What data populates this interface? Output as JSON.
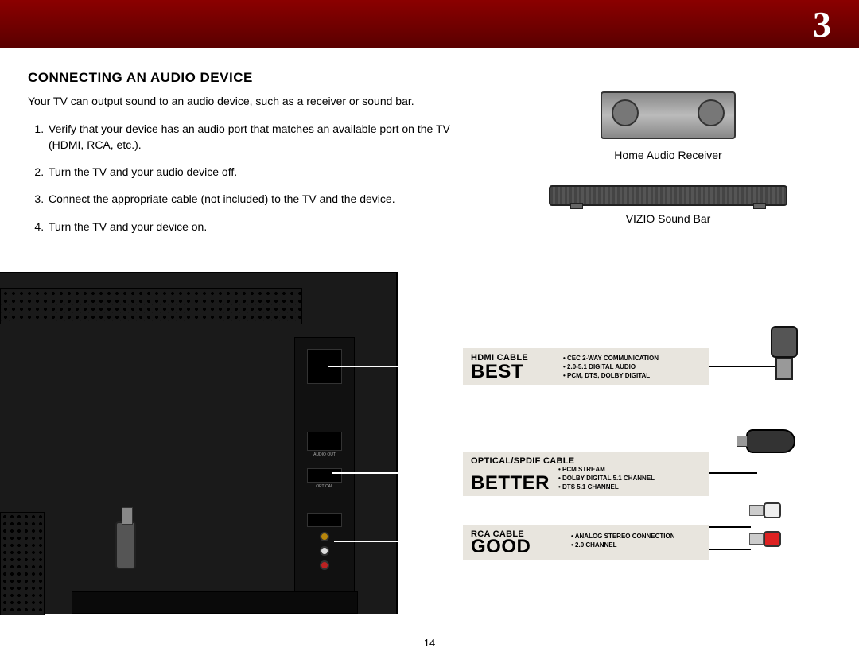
{
  "chapter_number": "3",
  "section_title": "CONNECTING AN AUDIO DEVICE",
  "intro": "Your TV can output sound to an audio device, such as a receiver or sound bar.",
  "steps": [
    "Verify that your device has an audio port that matches an available port on the TV (HDMI, RCA, etc.).",
    "Turn the TV and your audio device off.",
    "Connect the appropriate cable (not included) to the TV and the device.",
    "Turn the TV and your device on."
  ],
  "devices": {
    "receiver_label": "Home Audio Receiver",
    "soundbar_label": "VIZIO Sound Bar"
  },
  "cables": {
    "best": {
      "type": "HDMI CABLE",
      "rating": "BEST",
      "features": [
        "CEC 2-WAY COMMUNICATION",
        "2.0-5.1 DIGITAL AUDIO",
        "PCM, DTS, DOLBY DIGITAL"
      ]
    },
    "better": {
      "type": "OPTICAL/SPDIF CABLE",
      "rating": "BETTER",
      "features": [
        "PCM STREAM",
        "DOLBY DIGITAL 5.1 CHANNEL",
        "DTS 5.1 CHANNEL"
      ]
    },
    "good": {
      "type": "RCA CABLE",
      "rating": "GOOD",
      "features": [
        "ANALOG STEREO CONNECTION",
        "2.0 CHANNEL"
      ]
    }
  },
  "port_labels": {
    "audio_out": "AUDIO OUT",
    "optical": "OPTICAL"
  },
  "page_number": "14"
}
